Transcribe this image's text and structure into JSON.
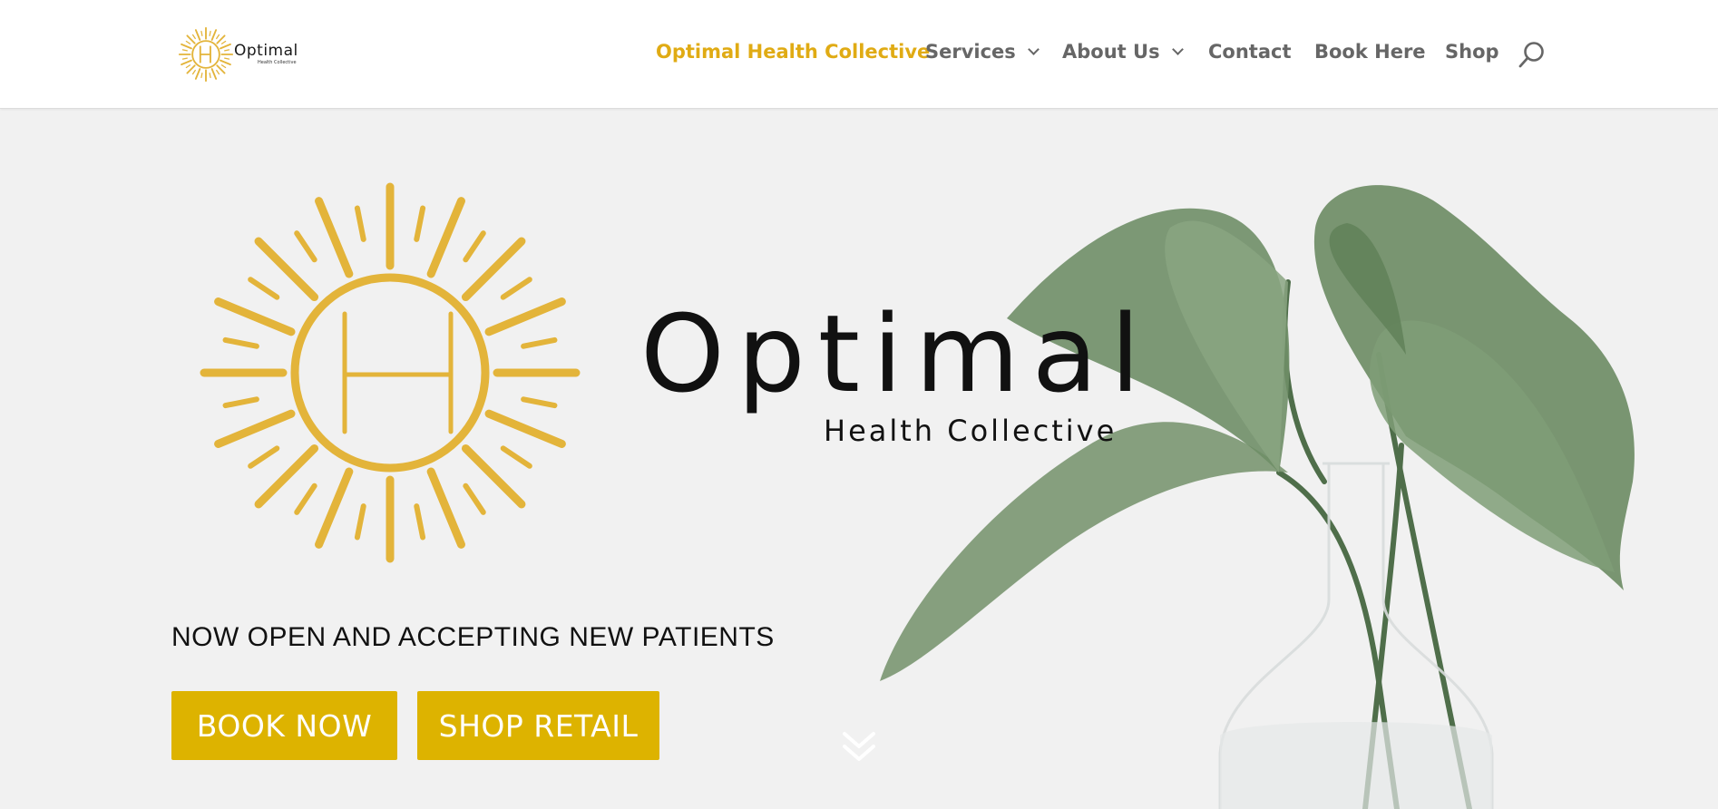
{
  "header": {
    "logo": {
      "name": "Optimal",
      "subtitle": "Health Collective"
    },
    "nav": [
      {
        "label": "Optimal Health Collective",
        "active": true,
        "has_dropdown": false
      },
      {
        "label": "Services",
        "active": false,
        "has_dropdown": true
      },
      {
        "label": "About Us",
        "active": false,
        "has_dropdown": true
      },
      {
        "label": "Contact",
        "active": false,
        "has_dropdown": false
      },
      {
        "label": "Book Here",
        "active": false,
        "has_dropdown": false
      },
      {
        "label": "Shop",
        "active": false,
        "has_dropdown": false
      }
    ],
    "search_icon": "search-icon"
  },
  "hero": {
    "logo": {
      "name": "Optimal",
      "subtitle": "Health Collective"
    },
    "tagline": "NOW OPEN AND ACCEPTING NEW PATIENTS",
    "buttons": {
      "book": "BOOK NOW",
      "shop": "SHOP RETAIL"
    },
    "scroll_icon": "chevron-double-down-icon"
  },
  "colors": {
    "accent": "#e0ab14",
    "button": "#ddb300",
    "nav_text": "#666666",
    "sun": "#e3b43a",
    "leaf": "#6f8e67"
  }
}
